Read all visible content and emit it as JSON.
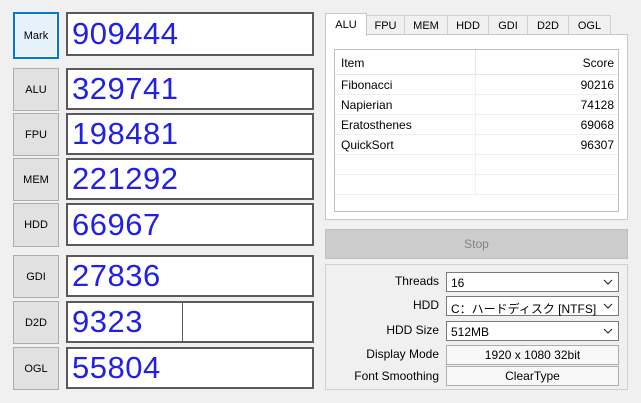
{
  "left_panel": {
    "mark": {
      "label": "Mark",
      "score": "909444"
    },
    "rows": [
      {
        "label": "ALU",
        "score": "329741"
      },
      {
        "label": "FPU",
        "score": "198481"
      },
      {
        "label": "MEM",
        "score": "221292"
      },
      {
        "label": "HDD",
        "score": "66967"
      },
      {
        "label": "GDI",
        "score": "27836"
      },
      {
        "label": "D2D",
        "score": "9323"
      },
      {
        "label": "OGL",
        "score": "55804"
      }
    ]
  },
  "tabs": {
    "items": [
      "ALU",
      "FPU",
      "MEM",
      "HDD",
      "GDI",
      "D2D",
      "OGL"
    ],
    "active": "ALU"
  },
  "results": {
    "columns": [
      "Item",
      "Score"
    ],
    "rows": [
      {
        "item": "Fibonacci",
        "score": "90216"
      },
      {
        "item": "Napierian",
        "score": "74128"
      },
      {
        "item": "Eratosthenes",
        "score": "69068"
      },
      {
        "item": "QuickSort",
        "score": "96307"
      }
    ]
  },
  "stop_button": {
    "label": "Stop",
    "enabled": false
  },
  "settings": {
    "threads": {
      "label": "Threads",
      "value": "16"
    },
    "hdd": {
      "label": "HDD",
      "value": "C：ハードディスク [NTFS]"
    },
    "hdd_size": {
      "label": "HDD Size",
      "value": "512MB"
    },
    "display_mode": {
      "label": "Display Mode",
      "value": "1920 x 1080 32bit"
    },
    "font_smoothing": {
      "label": "Font Smoothing",
      "value": "ClearType"
    }
  },
  "colors": {
    "score_text": "#2121e6",
    "focus_border": "#0078d7"
  }
}
